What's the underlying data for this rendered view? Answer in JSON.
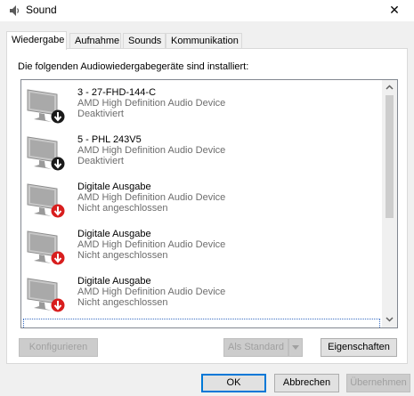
{
  "window": {
    "title": "Sound",
    "close_glyph": "✕"
  },
  "tabs": [
    {
      "label": "Wiedergabe",
      "active": true
    },
    {
      "label": "Aufnahme",
      "active": false
    },
    {
      "label": "Sounds",
      "active": false
    },
    {
      "label": "Kommunikation",
      "active": false
    }
  ],
  "panel": {
    "instruction": "Die folgenden Audiowiedergabegeräte sind installiert:"
  },
  "devices": [
    {
      "name": "3 - 27-FHD-144-C",
      "driver": "AMD High Definition Audio Device",
      "status": "Deaktiviert",
      "badge": "disabled-arrow-icon"
    },
    {
      "name": "5 - PHL 243V5",
      "driver": "AMD High Definition Audio Device",
      "status": "Deaktiviert",
      "badge": "disabled-arrow-icon"
    },
    {
      "name": "Digitale Ausgabe",
      "driver": "AMD High Definition Audio Device",
      "status": "Nicht angeschlossen",
      "badge": "unplugged-arrow-icon"
    },
    {
      "name": "Digitale Ausgabe",
      "driver": "AMD High Definition Audio Device",
      "status": "Nicht angeschlossen",
      "badge": "unplugged-arrow-icon"
    },
    {
      "name": "Digitale Ausgabe",
      "driver": "AMD High Definition Audio Device",
      "status": "Nicht angeschlossen",
      "badge": "unplugged-arrow-icon"
    }
  ],
  "buttons": {
    "configure": "Konfigurieren",
    "set_default": "Als Standard",
    "properties": "Eigenschaften",
    "ok": "OK",
    "cancel": "Abbrechen",
    "apply": "Übernehmen"
  },
  "colors": {
    "disabled_badge": "#1a1a1a",
    "unplugged_badge": "#d81e1e",
    "focus": "#0078d7"
  }
}
